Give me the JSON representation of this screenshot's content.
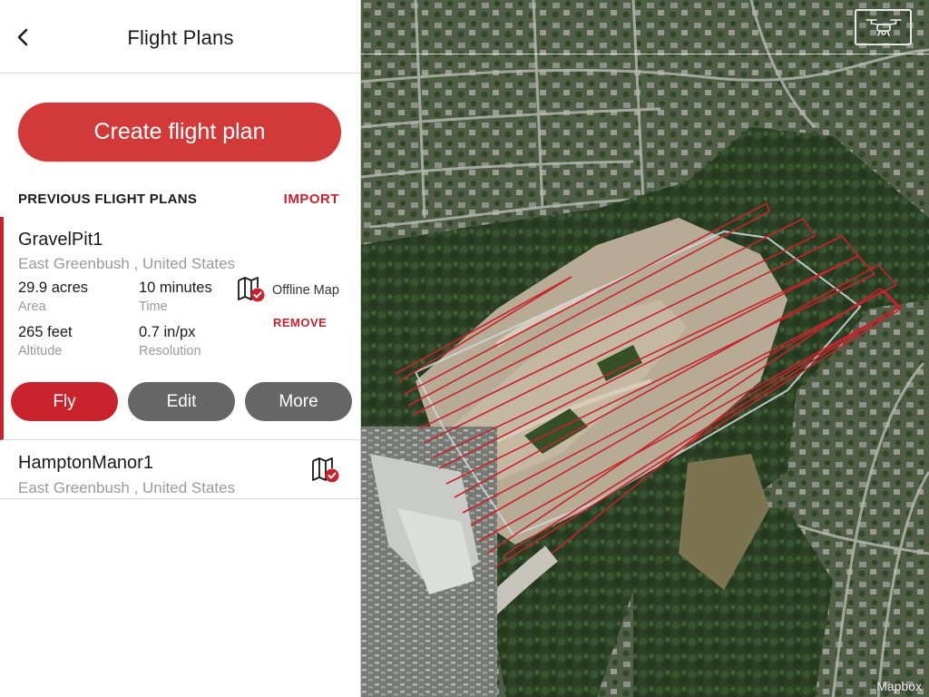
{
  "header": {
    "back_icon": "chevron-left-icon",
    "title": "Flight Plans"
  },
  "create_button_label": "Create flight plan",
  "section": {
    "title": "PREVIOUS FLIGHT PLANS",
    "import_label": "IMPORT"
  },
  "selected_plan": {
    "name": "GravelPit1",
    "location": "East Greenbush , United States",
    "area_value": "29.9 acres",
    "area_label": "Area",
    "time_value": "10 minutes",
    "time_label": "Time",
    "altitude_value": "265 feet",
    "altitude_label": "Altitude",
    "resolution_value": "0.7 in/px",
    "resolution_label": "Resolution",
    "offline_icon": "offline-map-check-icon",
    "offline_label": "Offline Map",
    "remove_label": "REMOVE",
    "buttons": {
      "fly": "Fly",
      "edit": "Edit",
      "more": "More"
    }
  },
  "plans": [
    {
      "name": "HamptonManor1",
      "location": "East Greenbush , United States",
      "icon": "offline-map-check-icon"
    }
  ],
  "map": {
    "drone_icon": "drone-icon",
    "attribution": "Mapbox"
  },
  "colors": {
    "accent": "#c8232c",
    "create_button": "#d23a3a",
    "secondary_button": "#666666",
    "flight_path": "#c8232c",
    "boundary": "#cfd6da"
  }
}
